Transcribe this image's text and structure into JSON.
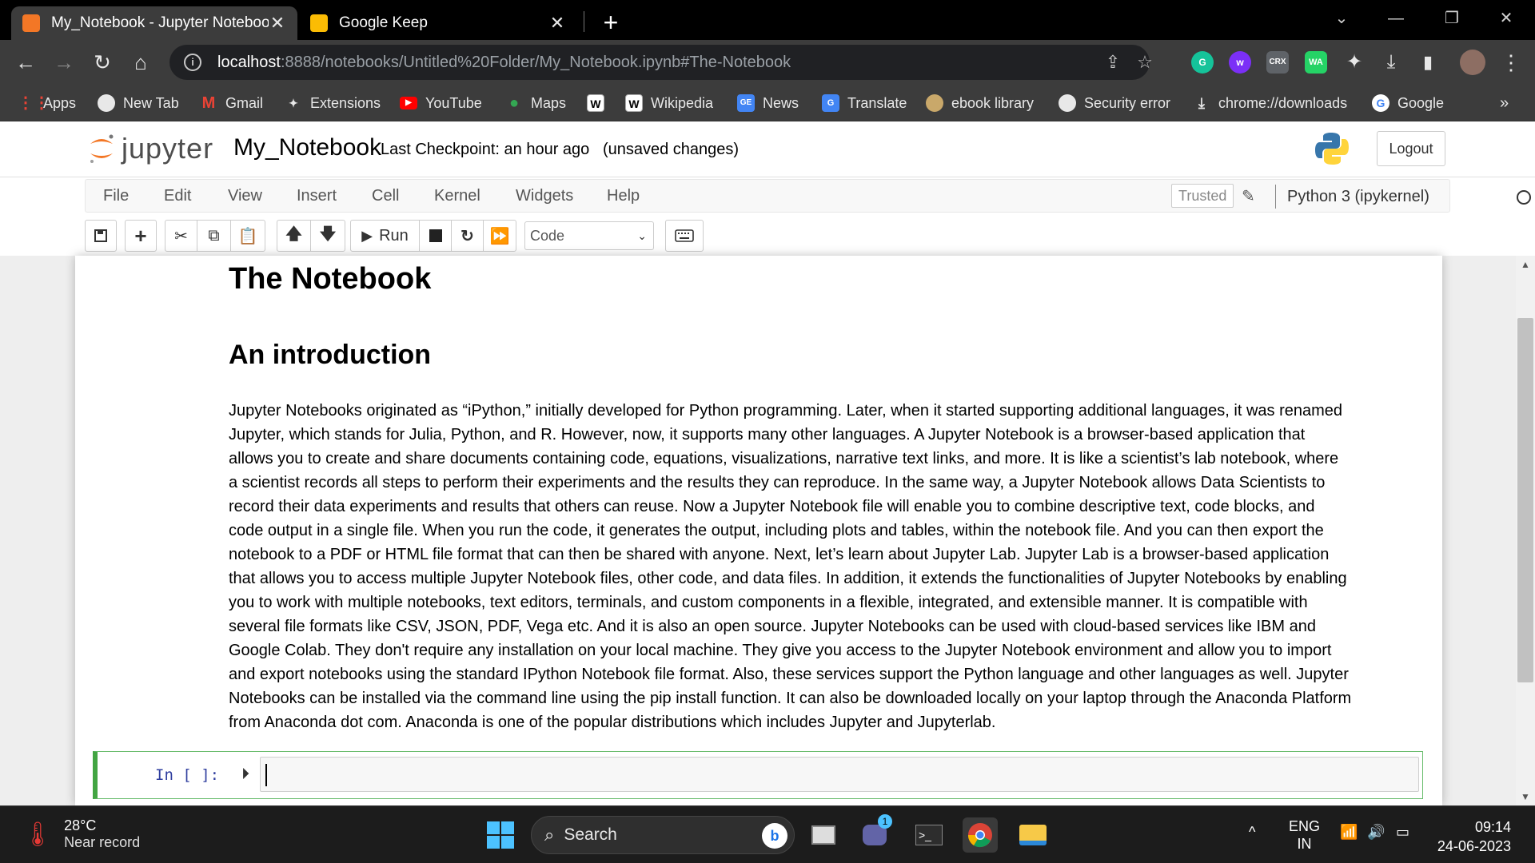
{
  "browser": {
    "tabs": [
      {
        "title": "My_Notebook - Jupyter Notebook",
        "active": true,
        "icon": "jupyter-book-icon"
      },
      {
        "title": "Google Keep",
        "active": false,
        "icon": "google-keep-icon"
      }
    ],
    "address": {
      "host": "localhost",
      "rest": ":8888/notebooks/Untitled%20Folder/My_Notebook.ipynb#The-Notebook"
    },
    "bookmarks": [
      {
        "label": "Apps",
        "icon": "apps-grid-icon"
      },
      {
        "label": "New Tab",
        "icon": "globe-icon"
      },
      {
        "label": "Gmail",
        "icon": "gmail-icon"
      },
      {
        "label": "Extensions",
        "icon": "puzzle-icon"
      },
      {
        "label": "YouTube",
        "icon": "youtube-icon"
      },
      {
        "label": "Maps",
        "icon": "maps-icon"
      },
      {
        "label": "",
        "icon": "wikipedia-icon"
      },
      {
        "label": "Wikipedia",
        "icon": "wikipedia-icon"
      },
      {
        "label": "News",
        "icon": "google-news-icon"
      },
      {
        "label": "Translate",
        "icon": "google-translate-icon"
      },
      {
        "label": "ebook library",
        "icon": "ebook-icon"
      },
      {
        "label": "Security error",
        "icon": "globe-icon"
      },
      {
        "label": "chrome://downloads",
        "icon": "download-icon"
      },
      {
        "label": "Google",
        "icon": "google-icon"
      }
    ],
    "extensions": {
      "crx": "CRX",
      "wa": "WA"
    },
    "overflow": "»"
  },
  "jupyter": {
    "logo_text": "jupyter",
    "notebook_name": "My_Notebook",
    "checkpoint": "Last Checkpoint: an hour ago",
    "unsaved": "(unsaved changes)",
    "logout": "Logout",
    "menu": [
      "File",
      "Edit",
      "View",
      "Insert",
      "Cell",
      "Kernel",
      "Widgets",
      "Help"
    ],
    "trusted": "Trusted",
    "kernel": "Python 3 (ipykernel)",
    "run_label": "Run",
    "cell_type": "Code"
  },
  "notebook": {
    "h1": "The Notebook",
    "h2": "An introduction",
    "paragraph_lines": [
      "Jupyter Notebooks originated as “iPython,” initially developed for Python programming. Later, when it started supporting additional languages, it was renamed",
      "Jupyter, which stands for Julia, Python, and R. However, now, it supports many other languages. A Jupyter Notebook is a browser-based application that",
      "allows you to create and share documents containing code, equations, visualizations, narrative text links, and more. It is like a scientist’s lab notebook, where",
      "a scientist records all steps to perform their experiments and the results they can reproduce. In the same way, a Jupyter Notebook allows Data Scientists to",
      "record their data experiments and results that others can reuse. Now a Jupyter Notebook file will enable you to combine descriptive text, code blocks, and",
      "code output in a single file. When you run the code, it generates the output, including plots and tables, within the notebook file. And you can then export the",
      "notebook to a PDF or HTML file format that can then be shared with anyone. Next, let’s learn about Jupyter Lab. Jupyter Lab is a browser-based application",
      "that allows you to access multiple Jupyter Notebook files, other code, and data files. In addition, it extends the functionalities of Jupyter Notebooks by enabling",
      "you to work with multiple notebooks, text editors, terminals, and custom components in a flexible, integrated, and extensible manner. It is compatible with",
      "several file formats like CSV, JSON, PDF, Vega etc. And it is also an open source. Jupyter Notebooks can be used with cloud-based services like IBM and",
      "Google Colab. They don't require any installation on your local machine. They give you access to the Jupyter Notebook environment and allow you to import",
      "and export notebooks using the standard IPython Notebook file format. Also, these services support the Python language and other languages as well. Jupyter",
      "Notebooks can be installed via the command line using the pip install function. It can also be downloaded locally on your laptop through the Anaconda Platform",
      "from Anaconda dot com. Anaconda is one of the popular distributions which includes Jupyter and Jupyterlab."
    ],
    "prompt": "In [ ]:"
  },
  "taskbar": {
    "temperature": "28°C",
    "condition": "Near record",
    "search": "Search",
    "teams_badge": "1",
    "language": "ENG",
    "region": "IN",
    "time": "09:14",
    "date": "24-06-2023"
  },
  "colors": {
    "jupyter_orange": "#f37726",
    "cell_green": "#42a542",
    "prompt_blue": "#303f9f"
  }
}
